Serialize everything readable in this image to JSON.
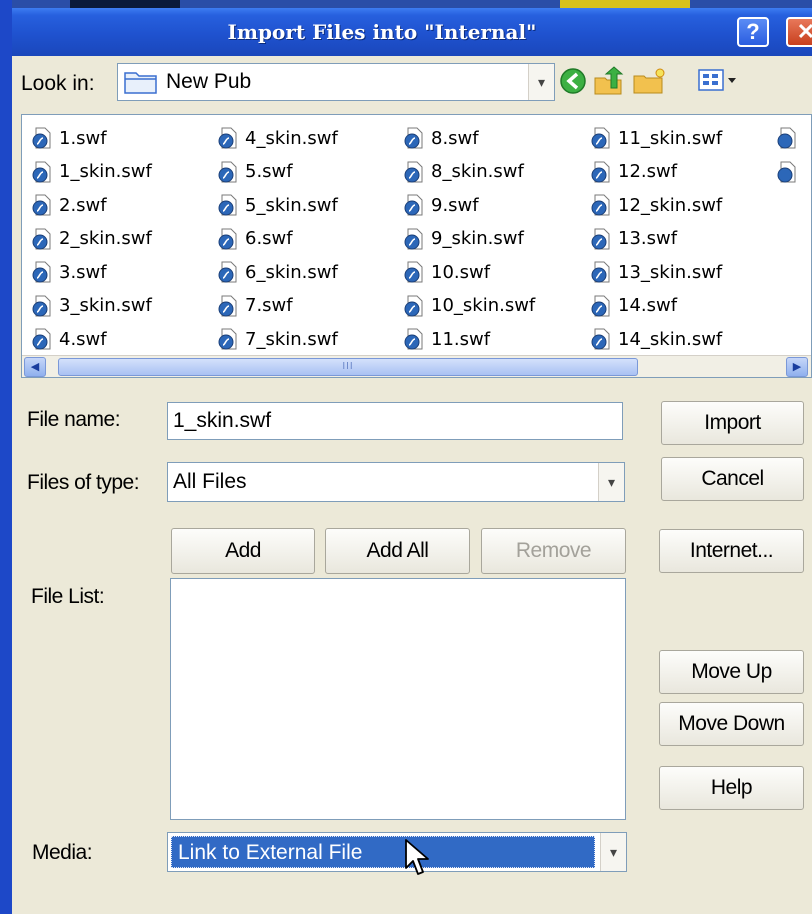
{
  "window": {
    "title": "Import Files into \"Internal\"",
    "help_glyph": "?",
    "close_glyph": "✕"
  },
  "look_in": {
    "label": "Look in:",
    "value": "New Pub"
  },
  "files": [
    "1.swf",
    "1_skin.swf",
    "2.swf",
    "2_skin.swf",
    "3.swf",
    "3_skin.swf",
    "4.swf",
    "4_skin.swf",
    "5.swf",
    "5_skin.swf",
    "6.swf",
    "6_skin.swf",
    "7.swf",
    "7_skin.swf",
    "8.swf",
    "8_skin.swf",
    "9.swf",
    "9_skin.swf",
    "10.swf",
    "10_skin.swf",
    "11.swf",
    "11_skin.swf",
    "12.swf",
    "12_skin.swf",
    "13.swf",
    "13_skin.swf",
    "14.swf",
    "14_skin.swf"
  ],
  "file_name": {
    "label": "File name:",
    "value": "1_skin.swf"
  },
  "file_type": {
    "label": "Files of type:",
    "value": "All Files"
  },
  "buttons": {
    "import": "Import",
    "cancel": "Cancel",
    "internet": "Internet...",
    "add": "Add",
    "add_all": "Add All",
    "remove": "Remove",
    "move_up": "Move Up",
    "move_down": "Move Down",
    "help": "Help"
  },
  "file_list_label": "File List:",
  "media": {
    "label": "Media:",
    "value": "Link to External File"
  },
  "icons": {
    "folder": "folder-icon",
    "back": "back-arrow-icon",
    "up": "up-folder-icon",
    "new_folder": "new-folder-icon",
    "views": "views-menu-icon",
    "swf_file": "swf-file-icon"
  },
  "colors": {
    "titlebar": "#2760de",
    "selection": "#316ac5",
    "dialog_bg": "#ece9d8"
  }
}
